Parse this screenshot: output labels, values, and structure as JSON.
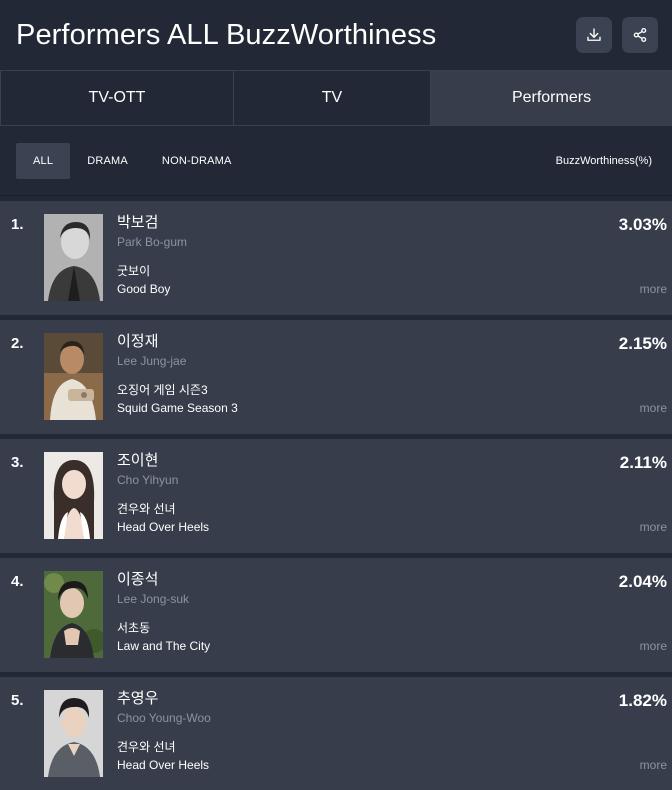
{
  "header": {
    "title": "Performers ALL BuzzWorthiness",
    "download_icon": "download-icon",
    "share_icon": "share-icon"
  },
  "tabs": [
    {
      "label": "TV-OTT",
      "active": false
    },
    {
      "label": "TV",
      "active": false
    },
    {
      "label": "Performers",
      "active": true
    }
  ],
  "filters": {
    "options": [
      {
        "label": "ALL",
        "active": true
      },
      {
        "label": "DRAMA",
        "active": false
      },
      {
        "label": "NON-DRAMA",
        "active": false
      }
    ],
    "metric_label": "BuzzWorthiness(%)"
  },
  "rankings": [
    {
      "rank": "1.",
      "name_ko": "박보검",
      "name_en": "Park Bo-gum",
      "show_ko": "굿보이",
      "show_en": "Good Boy",
      "percent": "3.03%",
      "more": "more"
    },
    {
      "rank": "2.",
      "name_ko": "이정재",
      "name_en": "Lee Jung-jae",
      "show_ko": "오징어 게임 시즌3",
      "show_en": "Squid Game Season 3",
      "percent": "2.15%",
      "more": "more"
    },
    {
      "rank": "3.",
      "name_ko": "조이현",
      "name_en": "Cho Yihyun",
      "show_ko": "견우와 선녀",
      "show_en": "Head Over Heels",
      "percent": "2.11%",
      "more": "more"
    },
    {
      "rank": "4.",
      "name_ko": "이종석",
      "name_en": "Lee Jong-suk",
      "show_ko": "서초동",
      "show_en": "Law and The City",
      "percent": "2.04%",
      "more": "more"
    },
    {
      "rank": "5.",
      "name_ko": "추영우",
      "name_en": "Choo Young-Woo",
      "show_ko": "견우와 선녀",
      "show_en": "Head Over Heels",
      "percent": "1.82%",
      "more": "more"
    }
  ],
  "colors": {
    "background": "#222836",
    "row_background": "#373d4b",
    "active_tab": "#373d4b",
    "muted_text": "#8d93a0"
  }
}
